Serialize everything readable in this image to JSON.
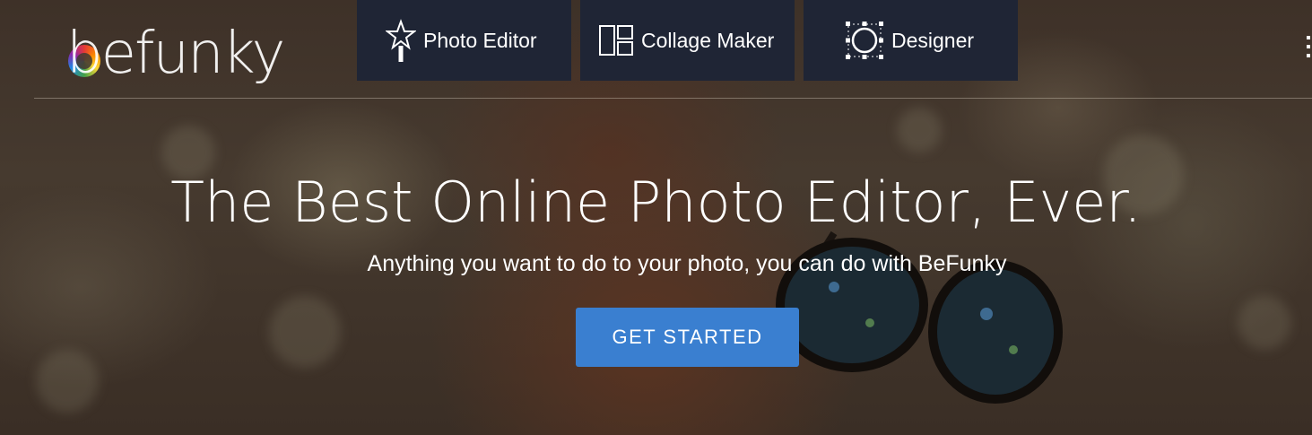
{
  "brand": {
    "logo_text": "befunky"
  },
  "nav": {
    "tabs": [
      {
        "label": "Photo Editor",
        "icon": "magic-wand-star-icon"
      },
      {
        "label": "Collage Maker",
        "icon": "collage-layout-icon"
      },
      {
        "label": "Designer",
        "icon": "design-selection-circle-icon"
      }
    ],
    "menu_icon": "vertical-dots-menu-icon"
  },
  "hero": {
    "headline": "The Best Online Photo Editor, Ever.",
    "subheadline": "Anything you want to do to your photo, you can do with BeFunky",
    "cta_label": "GET STARTED"
  },
  "colors": {
    "tab_bg": "#1f2535",
    "cta_bg": "#3a7fd0",
    "text": "#ffffff"
  }
}
